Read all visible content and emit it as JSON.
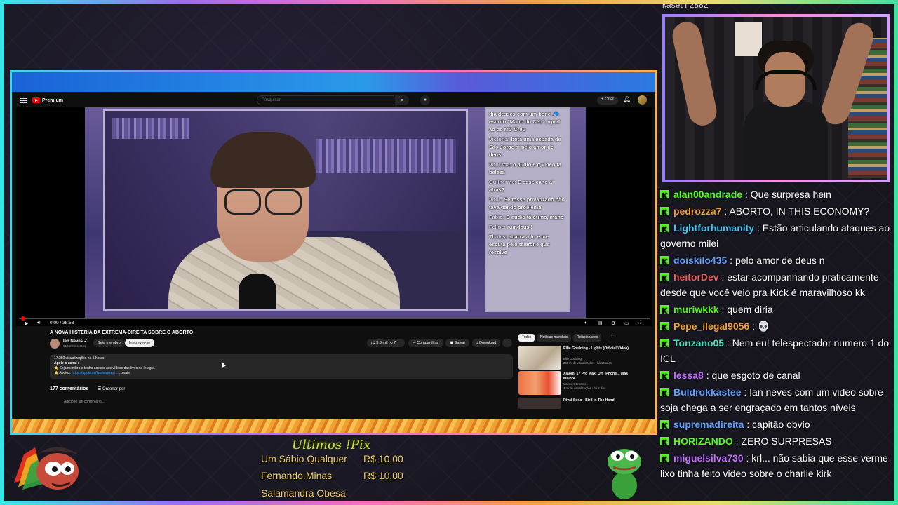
{
  "browser": {
    "brand": "Premium",
    "search_placeholder": "Pesquisar",
    "create_label": "+ Criar"
  },
  "video_overlay_chat": [
    {
      "user": "",
      "text": "dia desses com um boné 🧢 escrito \"Mano do Céu\", igual ao do MC Créu"
    },
    {
      "user": "Victoria:",
      "text": "bota uma espada de São Jorge aí pelo amor de deus"
    },
    {
      "user": "Vitor3da:",
      "text": "o áudio e o vídeo tá beleza"
    },
    {
      "user": "Guilherme:",
      "text": "E esse cano aí atrás?"
    },
    {
      "user": "Vitor:",
      "text": "Se fosse privatizado não tava dando problema"
    },
    {
      "user": "Fabio:",
      "text": "O audio tá ótimo, mano"
    },
    {
      "user": "Felipe:",
      "text": "ruindous !"
    },
    {
      "user": "Thales:",
      "text": "abaixa a tu e me escuta pelo telefone que resolve"
    }
  ],
  "player": {
    "time": "0:00 / 35:53",
    "progress": 0.0
  },
  "video": {
    "title": "A NOVA HISTERIA DA EXTREMA-DIREITA SOBRE O ABORTO",
    "channel": "Ian Neves ✓",
    "subscribers": "513 mil inscritos",
    "join_label": "Seja membro",
    "subscribe_label": "Inscrever-se",
    "likes": "3,6 mil",
    "dislikes": "7",
    "share_label": "Compartilhar",
    "save_label": "Salvar",
    "download_label": "Download",
    "desc_line1": "17.280 visualizações  há 5 horas",
    "desc_line2": "Apoie o canal :",
    "desc_line3": "⭐ Seja membro e tenha acesso aos vídeos das lives na íntegra.",
    "desc_line4_prefix": "⭐ Apoios:",
    "desc_line4_link": "https://apoia.se/iannevesepi...",
    "desc_more": "...mais",
    "comments_count": "177 comentários",
    "sort_label": "Ordenar por",
    "add_comment_placeholder": "Adicione um comentário..."
  },
  "related": {
    "chips": [
      "Todos",
      "Notícias mundiais",
      "Relacionados"
    ],
    "items": [
      {
        "title": "Ellie Goulding - Lights (Official Video)",
        "meta": "Ellie Goulding\n243 mi de visualizações · há 14 anos",
        "duration": "3:34"
      },
      {
        "title": "Xiaomi 17 Pro Max: Um iPhone... Mas Melhor",
        "meta": "Marques Brownlee\n4 mi de visualizações · há 2 dias",
        "duration": "11:52"
      },
      {
        "title": "Rival Sons - Bird In The Hand",
        "meta": "",
        "duration": ""
      }
    ]
  },
  "chat": {
    "top_partial": "kaset I 2882",
    "messages": [
      {
        "user": "alan00andrade",
        "color": "#53fc18",
        "text": "Que surpresa hein"
      },
      {
        "user": "pedrozza7",
        "color": "#f0a030",
        "text": "ABORTO, IN THIS ECONOMY?"
      },
      {
        "user": "Lightforhumanity",
        "color": "#40c8f0",
        "text": "Estão articulando ataques ao governo milei"
      },
      {
        "user": "doiskilo435",
        "color": "#60a0ff",
        "text": "pelo amor de deus n"
      },
      {
        "user": "heitorDev",
        "color": "#f06060",
        "text": "estar acompanhando praticamente desde que você veio pra Kick é maravilhoso kk"
      },
      {
        "user": "muriwkkk",
        "color": "#53fc18",
        "text": "quem diria"
      },
      {
        "user": "Pepe_ilegal9056",
        "color": "#f0a030",
        "text": "💀"
      },
      {
        "user": "Tonzano05",
        "color": "#40e0c0",
        "text": "Nem eu! telespectador numero 1 do ICL"
      },
      {
        "user": "lessa8",
        "color": "#c070ff",
        "text": "que esgoto de canal"
      },
      {
        "user": "Buldrokkastee",
        "color": "#60a0ff",
        "text": "Ian neves com um video sobre soja chega a ser engraçado em tantos níveis"
      },
      {
        "user": "supremadireita",
        "color": "#60a0ff",
        "text": "capitão obvio"
      },
      {
        "user": "HORIZANDO",
        "color": "#53fc18",
        "text": "ZERO SURPRESAS"
      },
      {
        "user": "miguelsilva730",
        "color": "#c070ff",
        "text": "krl... não sabia que esse verme lixo tinha feito video sobre o charlie kirk"
      }
    ]
  },
  "pix": {
    "title": "Ultimos !Pix",
    "entries": [
      {
        "name": "Um Sábio Qualquer",
        "amount": "R$ 10,00"
      },
      {
        "name": "Fernando.Minas",
        "amount": "R$ 10,00"
      },
      {
        "name": "Salamandra Obesa",
        "amount": ""
      }
    ]
  }
}
